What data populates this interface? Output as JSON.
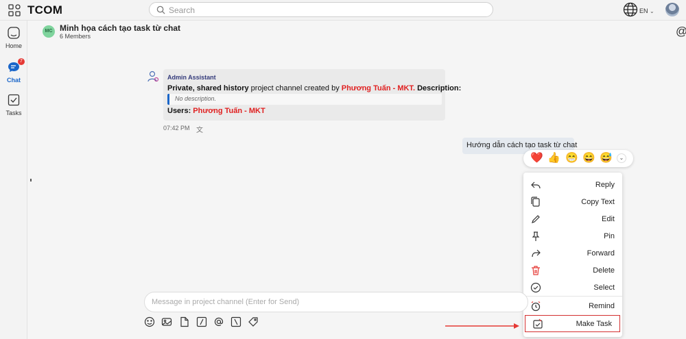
{
  "app": {
    "brand": "TCOM"
  },
  "search": {
    "placeholder": "Search"
  },
  "topbar": {
    "lang": "EN",
    "lang_chevron": "⌄"
  },
  "nav": {
    "items": [
      {
        "label": "Home",
        "icon": "home-icon"
      },
      {
        "label": "Chat",
        "icon": "chat-icon",
        "badge": "7"
      },
      {
        "label": "Tasks",
        "icon": "tasks-icon"
      }
    ]
  },
  "channel": {
    "avatar_initials": "MC",
    "title": "Minh họa cách tạo task từ chat",
    "members": "6 Members"
  },
  "system_message": {
    "sender": "Admin Assistant",
    "line1_a": "Private, shared history",
    "line1_b": " project channel created by ",
    "line1_c": "Phương Tuấn - MKT",
    "line1_d": ". ",
    "line1_e": "Description:",
    "quote": "No description.",
    "line3_a": "Users: ",
    "line3_b": "Phương Tuấn - MKT",
    "time": "07:42 PM",
    "translate_glyph": "文"
  },
  "my_message": {
    "text": "Hướng dẫn cách tạo task từ chat"
  },
  "reactions": {
    "emojis": [
      "❤️",
      "👍",
      "😁",
      "😄",
      "😅"
    ],
    "more": "⌄"
  },
  "context_menu": {
    "items": [
      {
        "label": "Reply",
        "icon": "reply-icon"
      },
      {
        "label": "Copy Text",
        "icon": "copy-icon"
      },
      {
        "label": "Edit",
        "icon": "edit-icon"
      },
      {
        "label": "Pin",
        "icon": "pin-icon"
      },
      {
        "label": "Forward",
        "icon": "forward-icon"
      },
      {
        "label": "Delete",
        "icon": "delete-icon"
      },
      {
        "label": "Select",
        "icon": "select-icon"
      },
      {
        "label": "Remind",
        "icon": "remind-icon"
      },
      {
        "label": "Make Task",
        "icon": "make-task-icon"
      }
    ]
  },
  "composer": {
    "placeholder": "Message in project channel (Enter for Send)"
  },
  "colors": {
    "accent": "#1a66c9",
    "mention": "#e02020",
    "highlight": "#d32f2f"
  }
}
